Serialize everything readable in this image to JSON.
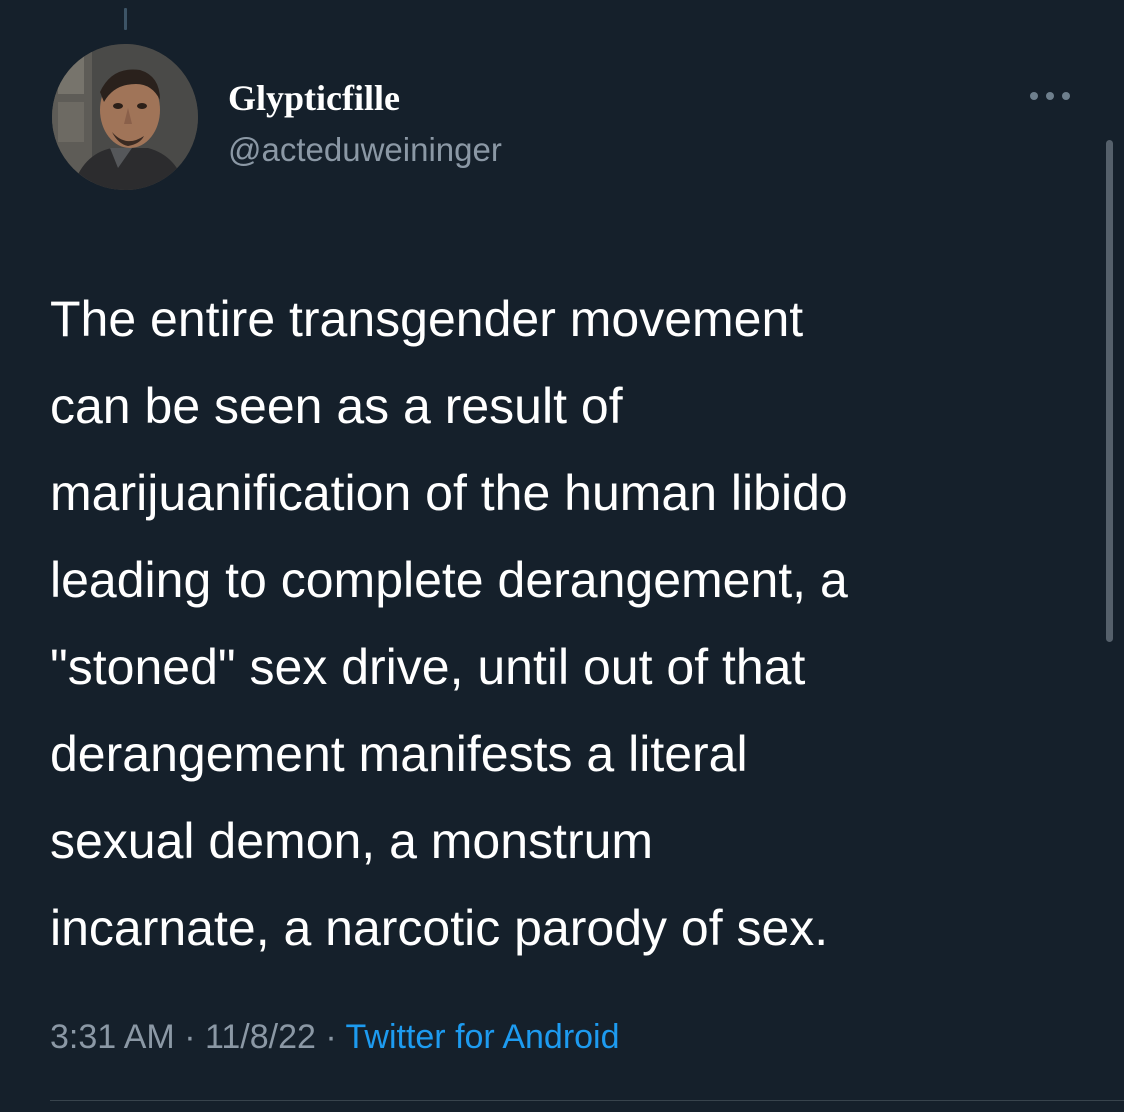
{
  "author": {
    "display_name": "Glypticfille",
    "handle": "@acteduweininger",
    "avatar_icon": "user-avatar-3d-character"
  },
  "tweet": {
    "text": "The entire transgender movement\ncan be seen as a result of\nmarijuanification of the human libido\nleading to complete derangement, a\n\"stoned\" sex drive, until out of that\nderangement manifests a literal\nsexual demon, a monstrum\nincarnate, a narcotic parody of sex."
  },
  "meta": {
    "time": "3:31 AM",
    "separator": " · ",
    "date": "11/8/22",
    "source": "Twitter for Android"
  },
  "colors": {
    "background": "#15202b",
    "text_primary": "#ffffff",
    "text_secondary": "#8b98a5",
    "link": "#1d9bf0"
  },
  "icons": {
    "more": "more-horizontal-icon"
  }
}
